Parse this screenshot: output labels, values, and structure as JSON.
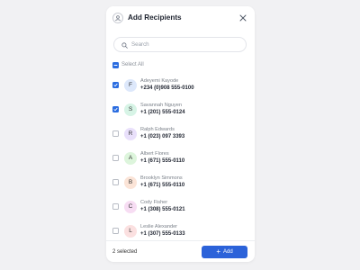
{
  "dialog": {
    "title": "Add Recipients",
    "header_icon": "user-icon",
    "close_icon": "close-icon"
  },
  "search": {
    "placeholder": "Search",
    "value": "",
    "icon": "search-icon"
  },
  "select_all": {
    "label": "Select All",
    "checked": true
  },
  "contacts": [
    {
      "name": "Adeyemi Kayode",
      "phone": "+234 (0)908 555-0100",
      "initial": "F",
      "avatar_color": "#dde8fb",
      "checked": true
    },
    {
      "name": "Savannah Nguyen",
      "phone": "+1 (201) 555-0124",
      "initial": "S",
      "avatar_color": "#d7f4e6",
      "checked": true
    },
    {
      "name": "Ralph Edwards",
      "phone": "+1 (023) 097 3393",
      "initial": "R",
      "avatar_color": "#e9e0fb",
      "checked": false
    },
    {
      "name": "Albert Flores",
      "phone": "+1 (671) 555-0110",
      "initial": "A",
      "avatar_color": "#ddf5dc",
      "checked": false
    },
    {
      "name": "Brooklyn Simmons",
      "phone": "+1 (671) 555-0110",
      "initial": "B",
      "avatar_color": "#fbe4d7",
      "checked": false
    },
    {
      "name": "Cody Fisher",
      "phone": "+1 (308) 555-0121",
      "initial": "C",
      "avatar_color": "#f7ddf3",
      "checked": false
    },
    {
      "name": "Leslie Alexander",
      "phone": "+1 (307) 555-0133",
      "initial": "L",
      "avatar_color": "#fbe0e0",
      "checked": false
    }
  ],
  "footer": {
    "selected_count": "2 selected",
    "add_label": "Add",
    "add_icon": "plus-icon"
  },
  "colors": {
    "accent": "#2b62d9",
    "checkbox_checked": "#2b6de0",
    "background": "#f1f1f3"
  }
}
